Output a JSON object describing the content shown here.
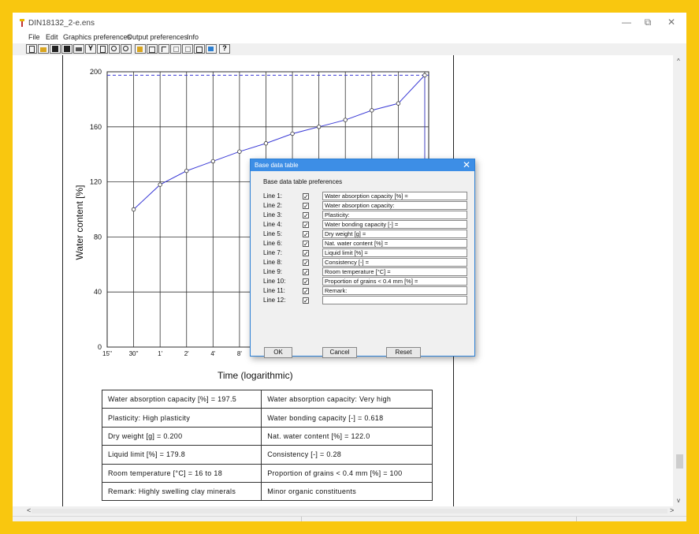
{
  "window": {
    "title": "DIN18132_2-e.ens",
    "minimize": "—",
    "restore": "⧉",
    "close": "✕"
  },
  "menu": [
    "File",
    "Edit",
    "Graphics preferences",
    "Output preferences",
    "Info"
  ],
  "toolbar": {
    "help_label": "?",
    "filter_label": "Y",
    "buttons": [
      "new-file-icon",
      "open-folder-icon",
      "save-icon",
      "save-as-icon",
      "print-icon",
      "filter-icon",
      "page-preview-icon",
      "zoom-in-icon",
      "zoom-out-icon",
      "fit-page-icon",
      "select-icon",
      "pointer-icon",
      "undo-icon",
      "redo-icon",
      "copy-icon",
      "export-icon",
      "help-icon"
    ]
  },
  "chart_data": {
    "type": "line",
    "xlabel": "Time  (logarithmic)",
    "ylabel": "Water content [%]",
    "x_ticks": [
      "15''",
      "30''",
      "1'",
      "2'",
      "4'",
      "8'"
    ],
    "y_ticks": [
      "0",
      "40",
      "80",
      "120",
      "160",
      "200"
    ],
    "ylim": [
      0,
      200
    ],
    "grid": true,
    "series": [
      {
        "points": [
          {
            "x": "30''",
            "y": 100
          },
          {
            "x": "1'",
            "y": 118
          },
          {
            "x": "2'",
            "y": 128
          },
          {
            "x": "4'",
            "y": 135
          },
          {
            "x": "8'",
            "y": 142
          },
          {
            "x": "16'",
            "y": 148
          },
          {
            "x": "32'",
            "y": 155
          },
          {
            "x": "1h",
            "y": 160
          },
          {
            "x": "2h",
            "y": 165
          },
          {
            "x": "4h",
            "y": 172
          },
          {
            "x": "6h",
            "y": 177
          },
          {
            "x": "24h",
            "y": 197.5
          }
        ]
      }
    ],
    "reference_line": {
      "y": 197.5,
      "style": "dashed"
    }
  },
  "results_table": [
    [
      "Water absorption capacity [%] =  197.5",
      "Water absorption capacity:  Very high"
    ],
    [
      "Plasticity:  High plasticity",
      "Water bonding capacity [-] =  0.618"
    ],
    [
      "Dry weight [g] =  0.200",
      "Nat. water content [%] =  122.0"
    ],
    [
      "Liquid limit [%] =  179.8",
      "Consistency [-] =  0.28"
    ],
    [
      "Room temperature [°C] =  16 to 18",
      "Proportion of grains < 0.4 mm [%] =  100"
    ],
    [
      "Remark:  Highly swelling clay minerals",
      "Minor organic constituents"
    ]
  ],
  "dialog": {
    "title": "Base data table",
    "subtitle": "Base data table preferences",
    "rows": [
      {
        "label": "Line 1:",
        "checked": true,
        "value": "Water absorption capacity [%] ="
      },
      {
        "label": "Line 2:",
        "checked": true,
        "value": "Water absorption capacity:"
      },
      {
        "label": "Line 3:",
        "checked": true,
        "value": "Plasticity:"
      },
      {
        "label": "Line 4:",
        "checked": true,
        "value": "Water bonding capacity [-] ="
      },
      {
        "label": "Line 5:",
        "checked": true,
        "value": "Dry weight [g] ="
      },
      {
        "label": "Line 6:",
        "checked": true,
        "value": "Nat. water content [%] ="
      },
      {
        "label": "Line 7:",
        "checked": true,
        "value": "Liquid limit [%] ="
      },
      {
        "label": "Line 8:",
        "checked": true,
        "value": "Consistency [-] ="
      },
      {
        "label": "Line 9:",
        "checked": true,
        "value": "Room temperature [°C] ="
      },
      {
        "label": "Line 10:",
        "checked": true,
        "value": "Proportion of grains < 0.4 mm [%] ="
      },
      {
        "label": "Line 11:",
        "checked": true,
        "value": "Remark:"
      },
      {
        "label": "Line 12:",
        "checked": true,
        "value": ""
      }
    ],
    "ok_label": "OK",
    "cancel_label": "Cancel",
    "reset_label": "Reset"
  },
  "colors": {
    "series": "#3a3ad6",
    "dialog_title": "#3d8ee6",
    "border": "#f9c70f"
  }
}
